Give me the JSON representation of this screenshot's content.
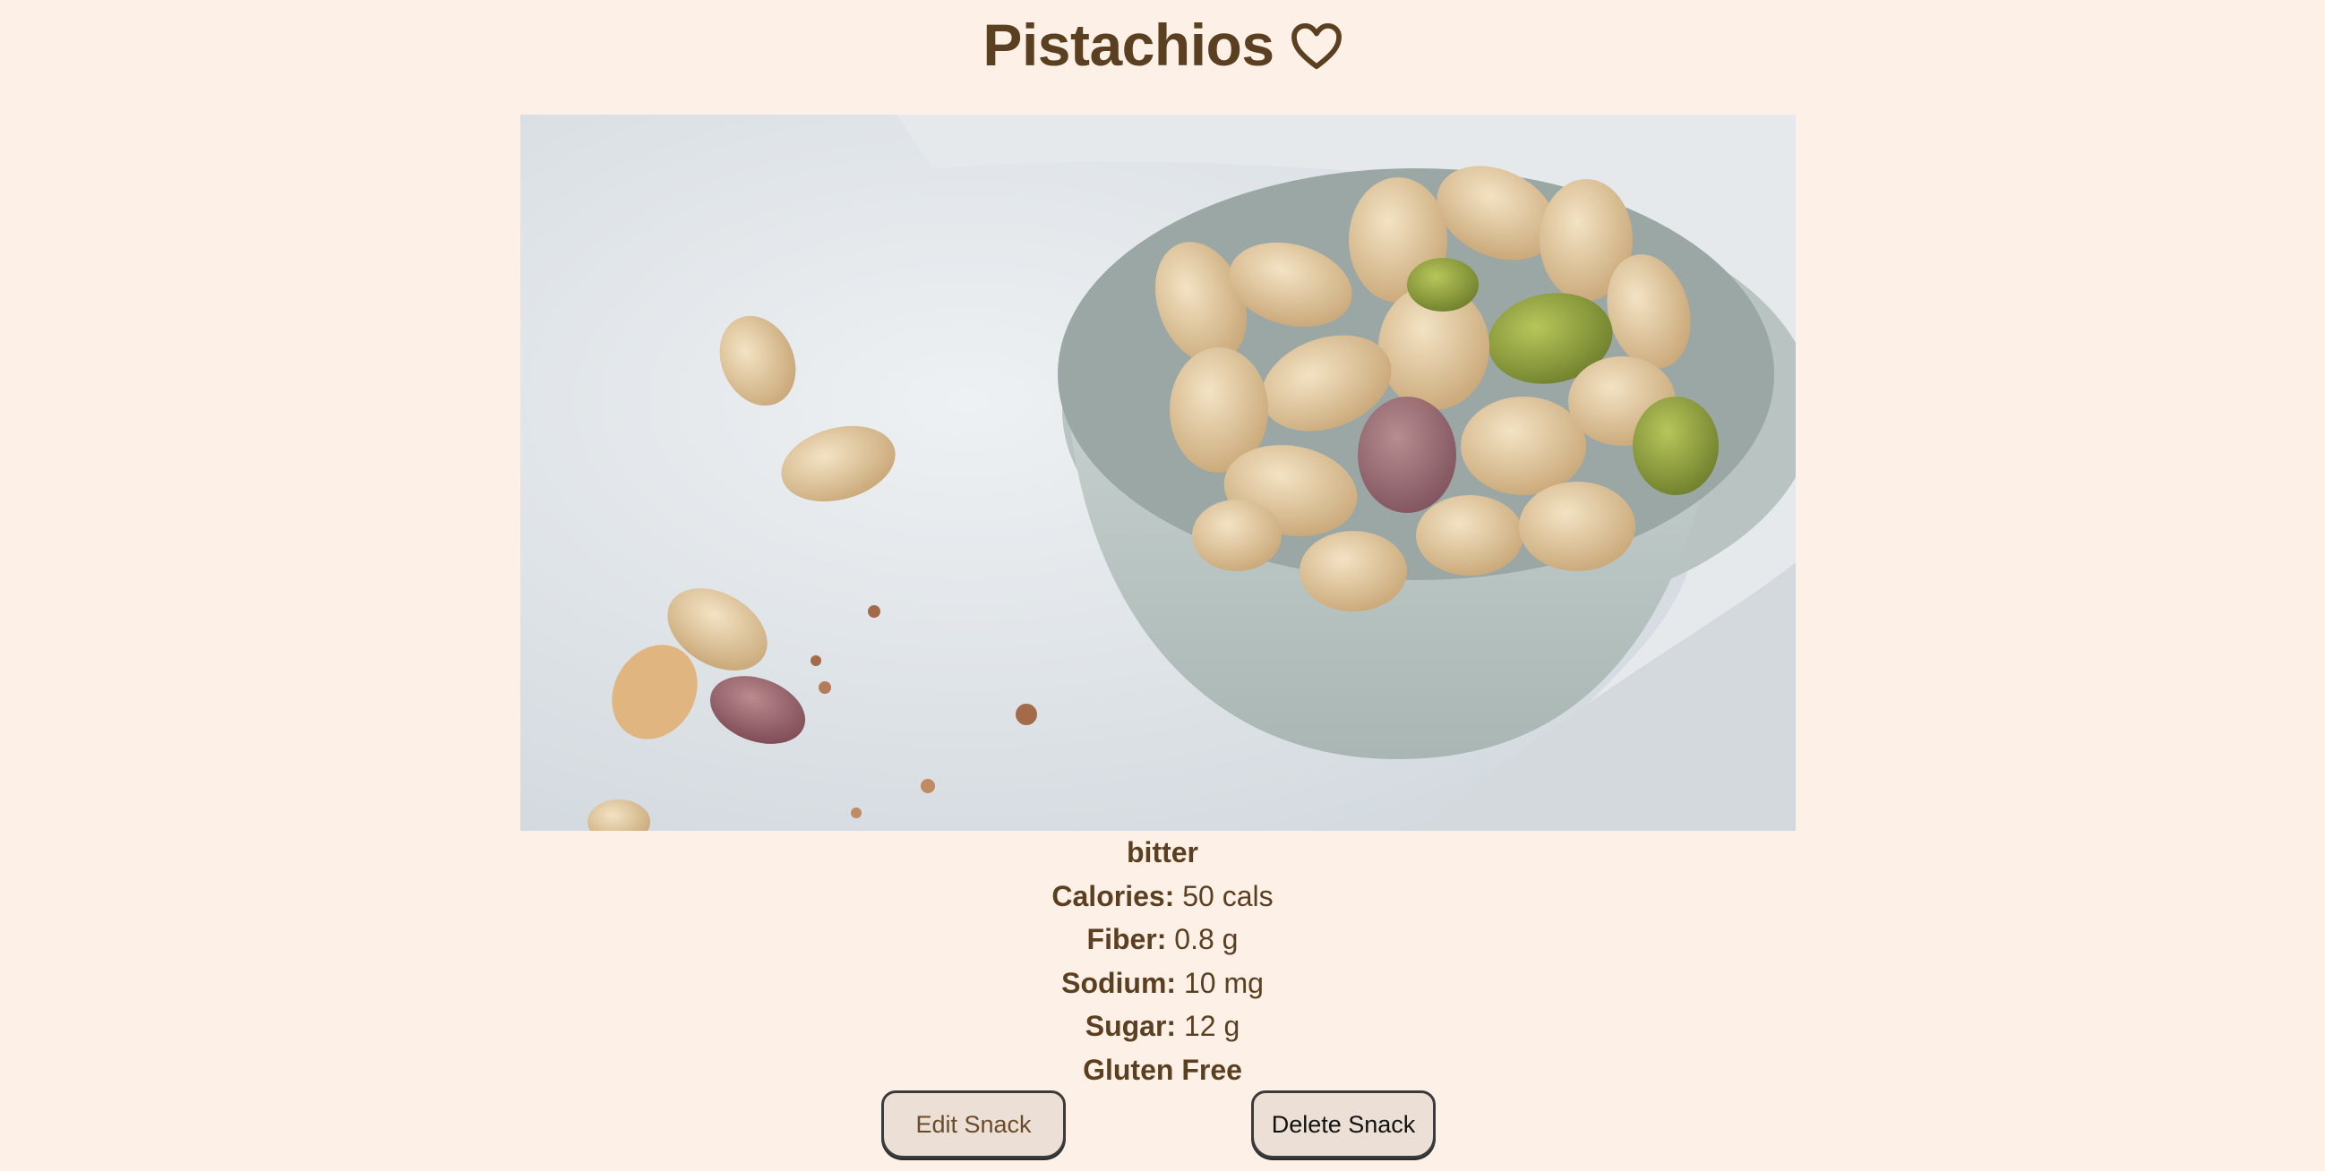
{
  "snack": {
    "name": "Pistachios",
    "favorite_icon": "heart-outline-icon",
    "image_alt": "Pistachios",
    "flavor": "bitter",
    "nutrition": [
      {
        "label": "Calories:",
        "value": "50 cals"
      },
      {
        "label": "Fiber:",
        "value": "0.8 g"
      },
      {
        "label": "Sodium:",
        "value": "10 mg"
      },
      {
        "label": "Sugar:",
        "value": "12 g"
      }
    ],
    "tag": "Gluten Free"
  },
  "actions": {
    "edit_label": "Edit Snack",
    "delete_label": "Delete Snack"
  },
  "colors": {
    "background": "#fdf0e6",
    "text": "#5b3f21",
    "button_bg": "#ece0d6"
  }
}
